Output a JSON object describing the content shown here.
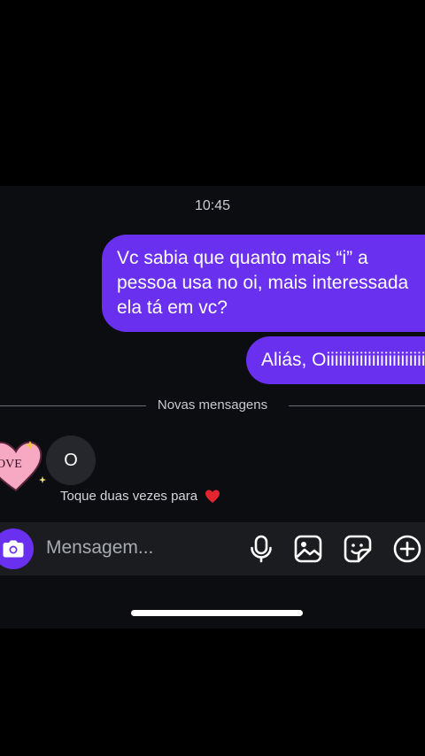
{
  "chat": {
    "timestamp": "10:45",
    "outgoing": [
      {
        "lines": [
          "Vc sabia que quanto mais “i” a",
          "pessoa usa no oi, mais interessada",
          "ela tá em vc?"
        ]
      },
      {
        "text": "Aliás, Oiiiiiiiiiiiiiiiiiiiiiiiiiii"
      }
    ],
    "divider_label": "Novas mensagens",
    "incoming": {
      "text": "O",
      "sticker_text": "OVE"
    },
    "hint": "Toque duas vezes para"
  },
  "composer": {
    "placeholder": "Mensagem...",
    "icons": [
      "camera-icon",
      "microphone-icon",
      "gallery-icon",
      "sticker-icon",
      "plus-icon"
    ]
  },
  "colors": {
    "outgoing_bubble": "#6a30f0",
    "incoming_bubble": "#26272d",
    "background": "#0c0d10",
    "composer": "#1b1c20"
  }
}
